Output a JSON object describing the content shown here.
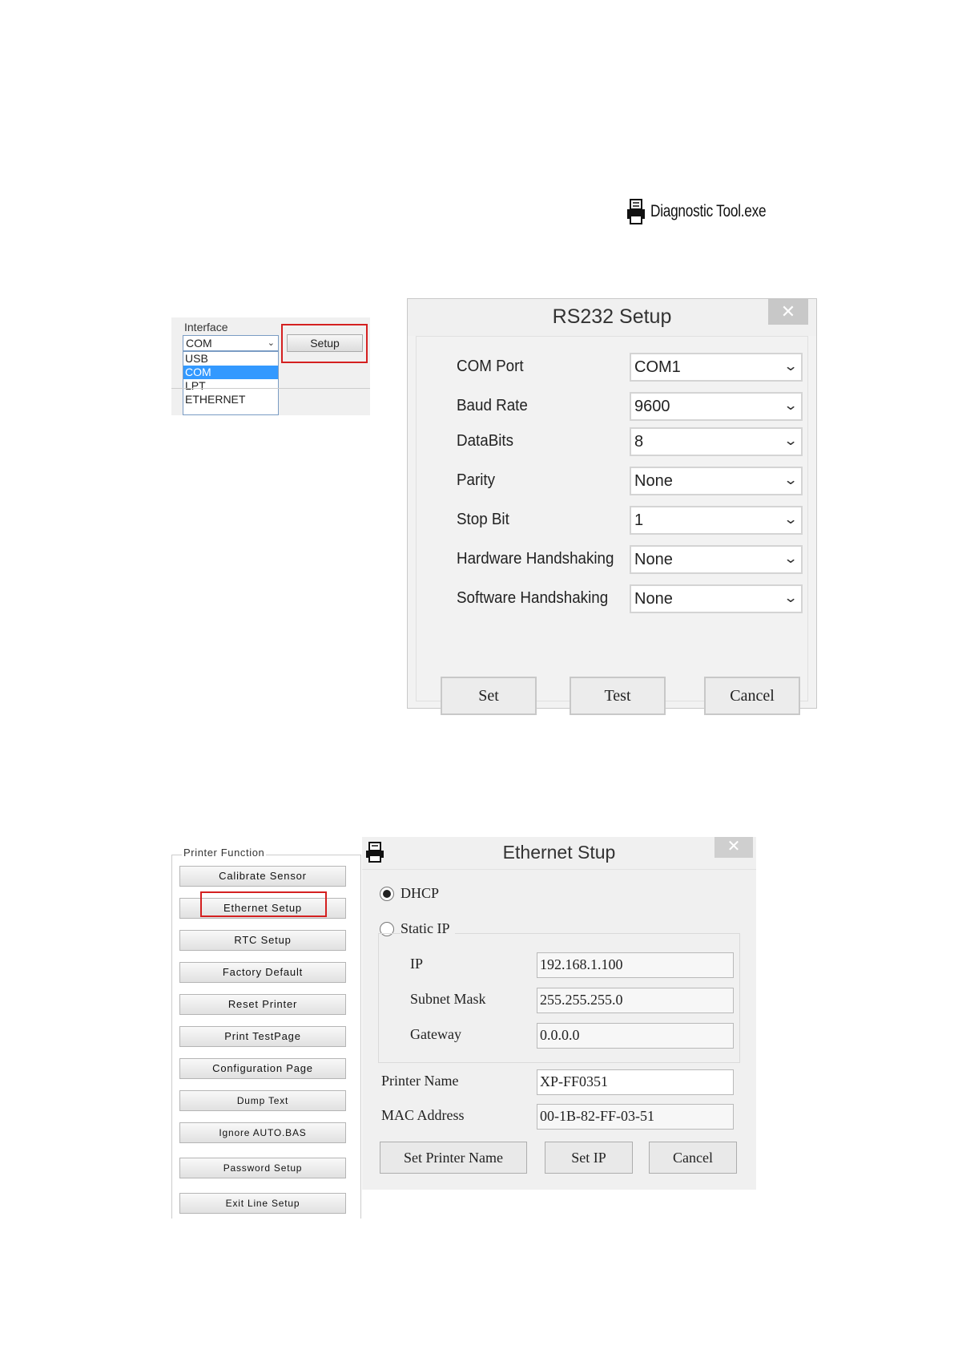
{
  "file": {
    "label": "Diagnostic Tool.exe",
    "icon": "printer-icon"
  },
  "interface": {
    "title": "Interface",
    "selected": "COM",
    "options": [
      "USB",
      "COM",
      "LPT",
      "ETHERNET"
    ],
    "setup_label": "Setup"
  },
  "rs232": {
    "title": "RS232 Setup",
    "close": "✕",
    "rows": [
      {
        "label": "COM Port",
        "value": "COM1"
      },
      {
        "label": "Baud Rate",
        "value": "9600"
      },
      {
        "label": "DataBits",
        "value": "8"
      },
      {
        "label": "Parity",
        "value": "None"
      },
      {
        "label": "Stop Bit",
        "value": "1"
      },
      {
        "label": "Hardware Handshaking",
        "value": "None"
      },
      {
        "label": "Software Handshaking",
        "value": "None"
      }
    ],
    "buttons": {
      "set": "Set",
      "test": "Test",
      "cancel": "Cancel"
    }
  },
  "printer_function": {
    "legend": "Printer  Function",
    "buttons": [
      "Calibrate Sensor",
      "Ethernet Setup",
      "RTC Setup",
      "Factory Default",
      "Reset Printer",
      "Print TestPage",
      "Configuration Page",
      "Dump Text",
      "Ignore AUTO.BAS",
      "Password Setup",
      "Exit Line Setup"
    ]
  },
  "ethernet": {
    "title": "Ethernet Stup",
    "close": "✕",
    "dhcp_label": "DHCP",
    "static_label": "Static IP",
    "mode": "DHCP",
    "ip_label": "IP",
    "ip": "192.168.1.100",
    "subnet_label": "Subnet Mask",
    "subnet": "255.255.255.0",
    "gateway_label": "Gateway",
    "gateway": "0.0.0.0",
    "printer_name_label": "Printer Name",
    "printer_name": "XP-FF0351",
    "mac_label": "MAC Address",
    "mac": "00-1B-82-FF-03-51",
    "buttons": {
      "set_name": "Set Printer Name",
      "set_ip": "Set IP",
      "cancel": "Cancel"
    }
  },
  "colors": {
    "highlight": "#d42020",
    "selection": "#3399ff"
  }
}
